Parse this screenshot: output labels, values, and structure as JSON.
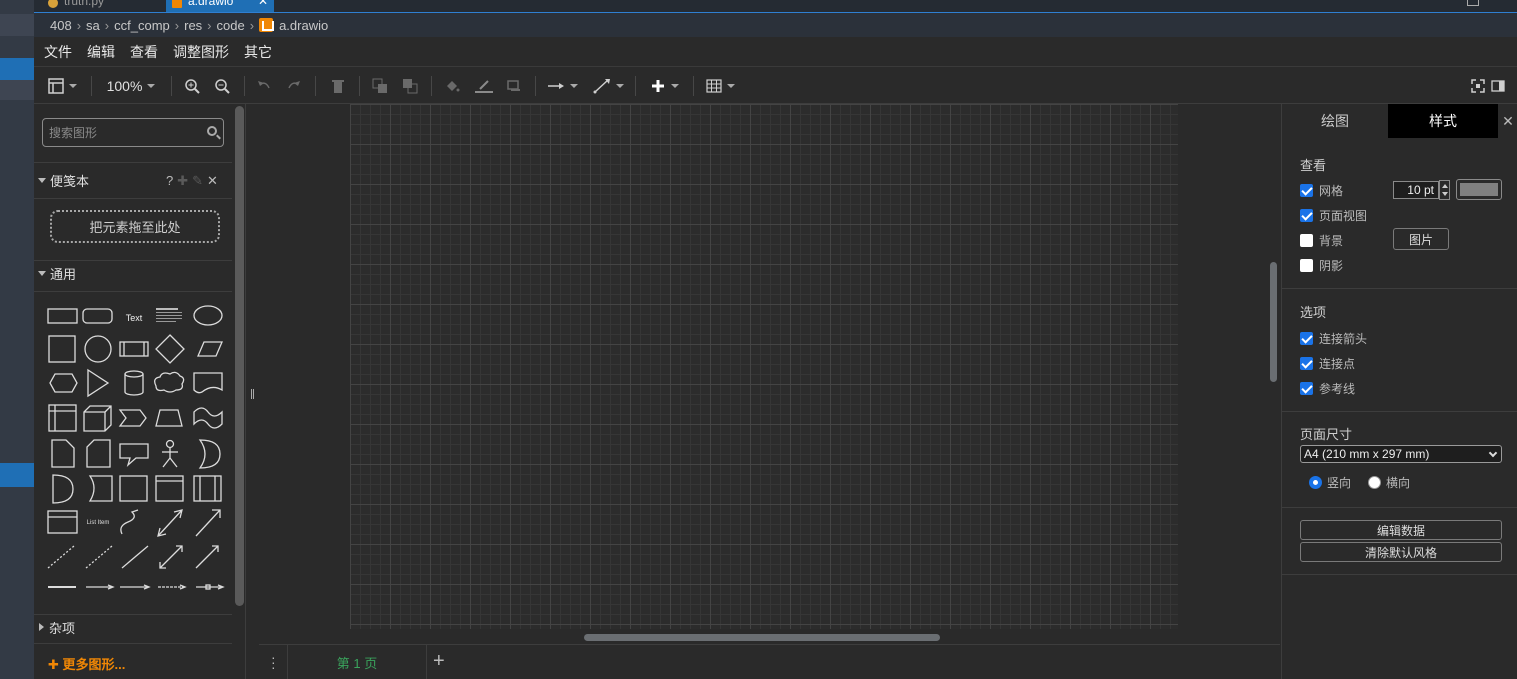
{
  "editor_tabs": [
    {
      "label": "truth.py",
      "active": false
    },
    {
      "label": "a.drawio",
      "active": true
    }
  ],
  "breadcrumb": [
    "408",
    "sa",
    "ccf_comp",
    "res",
    "code",
    "a.drawio"
  ],
  "menu": [
    "文件",
    "编辑",
    "查看",
    "调整图形",
    "其它"
  ],
  "toolbar": {
    "zoom": "100%",
    "icons": [
      "format-panel-icon",
      "zoom-in-icon",
      "zoom-out-icon",
      "undo-icon",
      "redo-icon",
      "delete-icon",
      "to-front-icon",
      "to-back-icon",
      "fill-color-icon",
      "line-color-icon",
      "shadow-icon",
      "connection-icon",
      "waypoints-icon",
      "insert-icon",
      "table-icon",
      "fullscreen-icon",
      "toggle-panel-icon"
    ]
  },
  "left_panel": {
    "search_placeholder": "搜索图形",
    "scratchpad": {
      "title": "便笺本",
      "help": "?",
      "dropzone": "把元素拖至此处"
    },
    "general": {
      "title": "通用",
      "shape_text": "Text",
      "list_item_text": "List Item"
    },
    "misc": {
      "title": "杂项"
    },
    "more_shapes": "✚ 更多图形..."
  },
  "page_tabs": {
    "current": "第 1 页"
  },
  "format_panel": {
    "tabs": [
      "绘图",
      "样式"
    ],
    "active_tab": "样式",
    "view": {
      "title": "查看",
      "grid": {
        "label": "网格",
        "checked": true,
        "size": "10 pt",
        "color": "#808080"
      },
      "page_view": {
        "label": "页面视图",
        "checked": true
      },
      "background": {
        "label": "背景",
        "checked": false,
        "button": "图片"
      },
      "shadow": {
        "label": "阴影",
        "checked": false
      }
    },
    "options": {
      "title": "选项",
      "connection_arrows": {
        "label": "连接箭头",
        "checked": true
      },
      "connection_points": {
        "label": "连接点",
        "checked": true
      },
      "guides": {
        "label": "参考线",
        "checked": true
      }
    },
    "paper_size": {
      "title": "页面尺寸",
      "selected": "A4 (210 mm x 297 mm)",
      "portrait": {
        "label": "竖向",
        "checked": true
      },
      "landscape": {
        "label": "横向",
        "checked": false
      }
    },
    "buttons": {
      "edit_data": "编辑数据",
      "clear_default_style": "清除默认风格"
    }
  },
  "colors": {
    "accent": "#1a73e8",
    "brand_orange": "#f08705",
    "page_tab_green": "#3aa35c"
  }
}
